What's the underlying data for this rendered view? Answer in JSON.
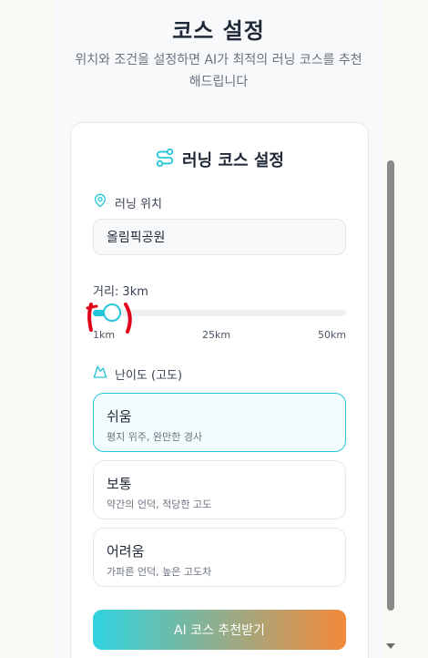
{
  "header": {
    "title": "코스 설정",
    "subtitle": "위치와 조건을 설정하면 AI가 최적의 러닝 코스를 추천해드립니다"
  },
  "card": {
    "title": "러닝 코스 설정",
    "title_icon": "route-icon"
  },
  "location": {
    "label": "러닝 위치",
    "icon": "map-pin-icon",
    "value": "올림픽공원"
  },
  "distance": {
    "label": "거리: 3km",
    "value_km": 3,
    "min_km": 1,
    "max_km": 50,
    "ticks": [
      "1km",
      "25km",
      "50km"
    ]
  },
  "difficulty": {
    "label": "난이도 (고도)",
    "icon": "mountain-icon",
    "options": [
      {
        "title": "쉬움",
        "desc": "평지 위주, 완만한 경사",
        "selected": true
      },
      {
        "title": "보통",
        "desc": "약간의 언덕, 적당한 고도",
        "selected": false
      },
      {
        "title": "어려움",
        "desc": "가파른 언덕, 높은 고도차",
        "selected": false
      }
    ]
  },
  "submit": {
    "label": "AI 코스 추천받기"
  },
  "colors": {
    "accent": "#26c6da",
    "gradient_end": "#f3893a",
    "annotation": "#e0001b"
  }
}
